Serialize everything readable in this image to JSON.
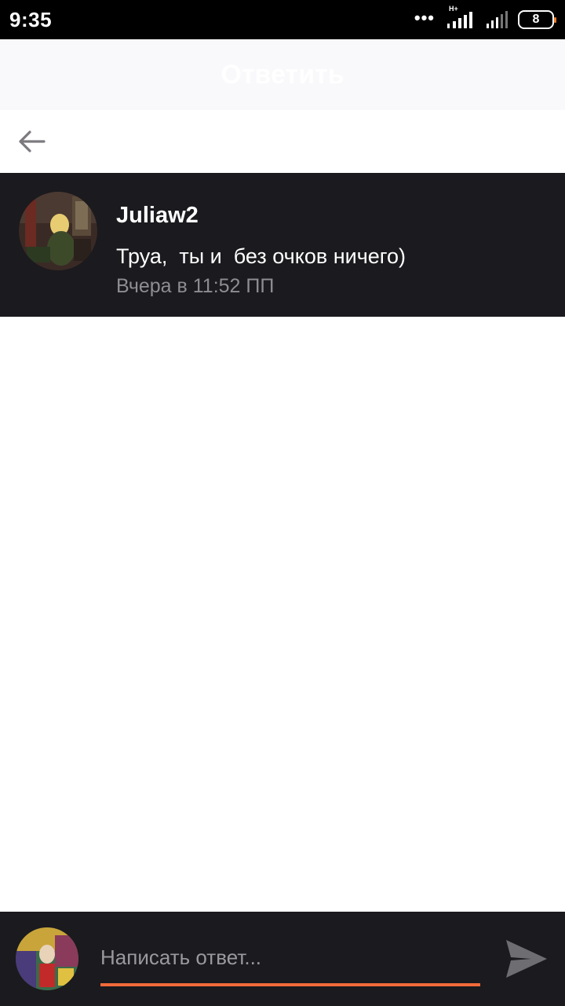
{
  "status_bar": {
    "time": "9:35",
    "network_type": "H+",
    "battery_level": "8",
    "icons": [
      "dots-icon",
      "signal-icon",
      "signal-icon",
      "battery-icon"
    ]
  },
  "header": {
    "title": "Ответить"
  },
  "nav": {
    "back_icon": "arrow-left-icon"
  },
  "comment": {
    "author": "Juliaw2",
    "text": "Труа,  ты и  без очков ничего)",
    "time": "Вчера в 11:52 ПП"
  },
  "compose": {
    "placeholder": "Написать ответ...",
    "value": "",
    "send_icon": "send-icon",
    "accent_color": "#f26a3b"
  },
  "colors": {
    "dark_bg": "#1b1a1e",
    "status_bg": "#000000",
    "muted_text": "#8e8d92"
  }
}
